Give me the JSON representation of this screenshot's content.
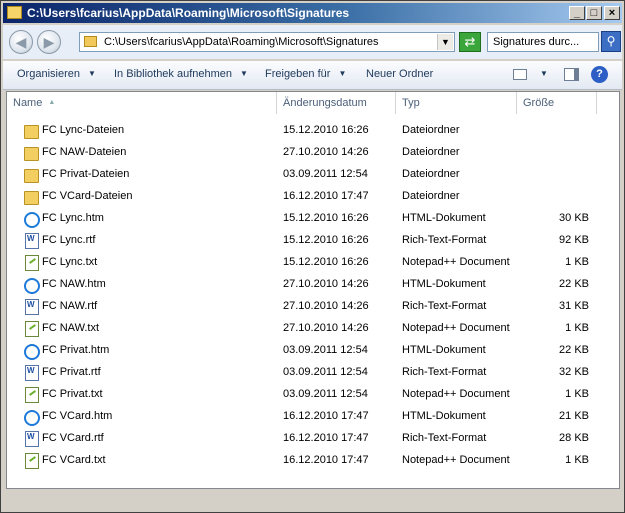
{
  "window": {
    "title": "C:\\Users\\fcarius\\AppData\\Roaming\\Microsoft\\Signatures",
    "controls": [
      "_",
      "□",
      "×"
    ]
  },
  "address": {
    "path": "C:\\Users\\fcarius\\AppData\\Roaming\\Microsoft\\Signatures",
    "search_placeholder": "Signatures durc..."
  },
  "commands": {
    "organize": "Organisieren",
    "library": "In Bibliothek aufnehmen",
    "share": "Freigeben für",
    "new_folder": "Neuer Ordner"
  },
  "columns": {
    "name": "Name",
    "date": "Änderungsdatum",
    "type": "Typ",
    "size": "Größe"
  },
  "files": [
    {
      "name": "FC Lync-Dateien",
      "date": "15.12.2010 16:26",
      "type": "Dateiordner",
      "size": "",
      "icon": "folder-icon"
    },
    {
      "name": "FC NAW-Dateien",
      "date": "27.10.2010 14:26",
      "type": "Dateiordner",
      "size": "",
      "icon": "folder-icon"
    },
    {
      "name": "FC Privat-Dateien",
      "date": "03.09.2011 12:54",
      "type": "Dateiordner",
      "size": "",
      "icon": "folder-icon"
    },
    {
      "name": "FC VCard-Dateien",
      "date": "16.12.2010 17:47",
      "type": "Dateiordner",
      "size": "",
      "icon": "folder-icon"
    },
    {
      "name": "FC Lync.htm",
      "date": "15.12.2010 16:26",
      "type": "HTML-Dokument",
      "size": "30 KB",
      "icon": "htm-icon"
    },
    {
      "name": "FC Lync.rtf",
      "date": "15.12.2010 16:26",
      "type": "Rich-Text-Format",
      "size": "92 KB",
      "icon": "rtf-icon"
    },
    {
      "name": "FC Lync.txt",
      "date": "15.12.2010 16:26",
      "type": "Notepad++ Document",
      "size": "1 KB",
      "icon": "txt-icon"
    },
    {
      "name": "FC NAW.htm",
      "date": "27.10.2010 14:26",
      "type": "HTML-Dokument",
      "size": "22 KB",
      "icon": "htm-icon"
    },
    {
      "name": "FC NAW.rtf",
      "date": "27.10.2010 14:26",
      "type": "Rich-Text-Format",
      "size": "31 KB",
      "icon": "rtf-icon"
    },
    {
      "name": "FC NAW.txt",
      "date": "27.10.2010 14:26",
      "type": "Notepad++ Document",
      "size": "1 KB",
      "icon": "txt-icon"
    },
    {
      "name": "FC Privat.htm",
      "date": "03.09.2011 12:54",
      "type": "HTML-Dokument",
      "size": "22 KB",
      "icon": "htm-icon"
    },
    {
      "name": "FC Privat.rtf",
      "date": "03.09.2011 12:54",
      "type": "Rich-Text-Format",
      "size": "32 KB",
      "icon": "rtf-icon"
    },
    {
      "name": "FC Privat.txt",
      "date": "03.09.2011 12:54",
      "type": "Notepad++ Document",
      "size": "1 KB",
      "icon": "txt-icon"
    },
    {
      "name": "FC VCard.htm",
      "date": "16.12.2010 17:47",
      "type": "HTML-Dokument",
      "size": "21 KB",
      "icon": "htm-icon"
    },
    {
      "name": "FC VCard.rtf",
      "date": "16.12.2010 17:47",
      "type": "Rich-Text-Format",
      "size": "28 KB",
      "icon": "rtf-icon"
    },
    {
      "name": "FC VCard.txt",
      "date": "16.12.2010 17:47",
      "type": "Notepad++ Document",
      "size": "1 KB",
      "icon": "txt-icon"
    }
  ]
}
